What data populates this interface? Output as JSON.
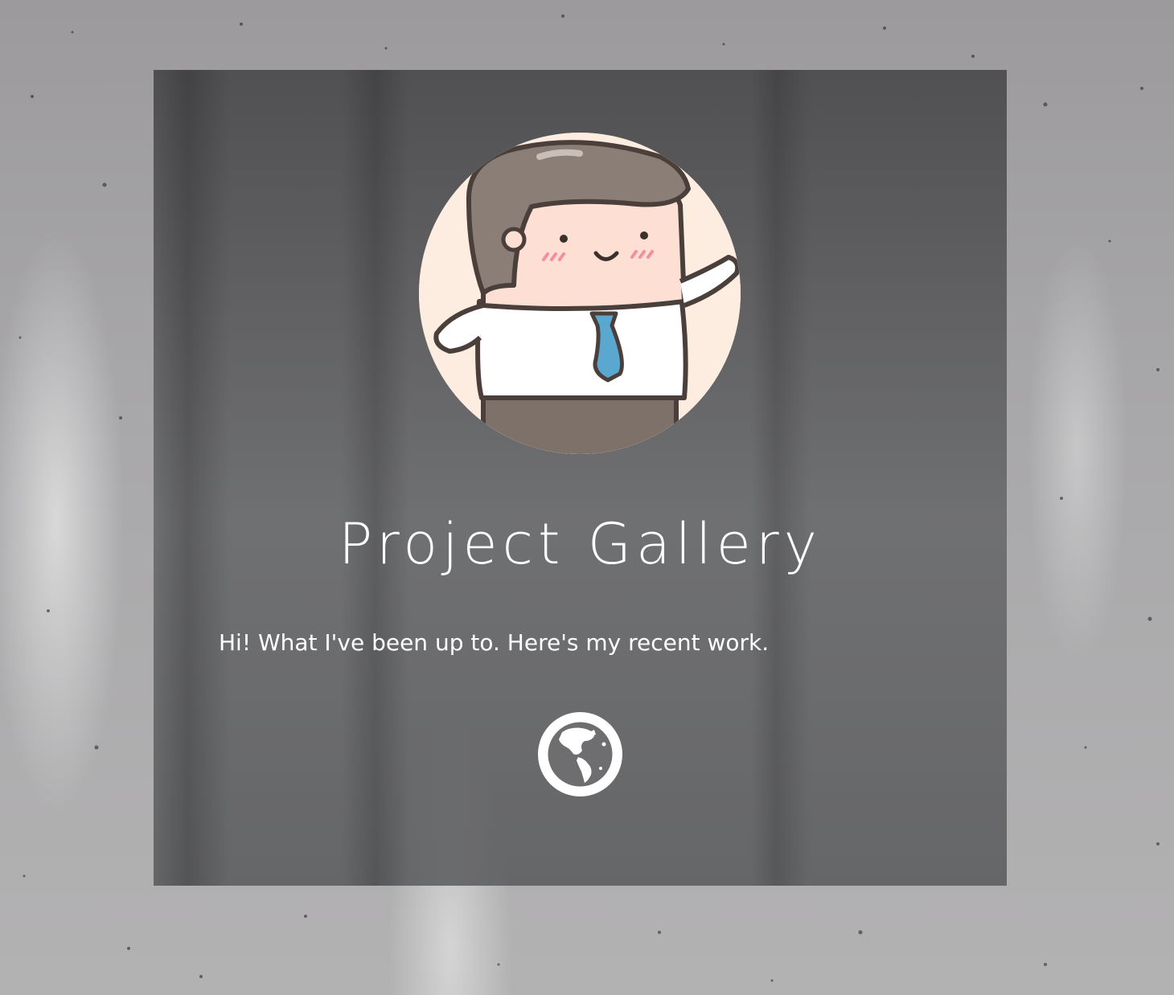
{
  "page": {
    "title": "Project Gallery",
    "subtitle": "Hi! What I've been up to. Here's my recent work."
  },
  "avatar": {
    "icon": "cartoon-businessman-avatar"
  },
  "globe_button": {
    "icon": "globe-icon"
  },
  "colors": {
    "card_overlay": "#5a5a5c",
    "text": "#ffffff",
    "avatar_bg": "#fdece0",
    "tie": "#5aa7d0",
    "hair": "#8a7e76",
    "outline": "#4a3f3a"
  }
}
